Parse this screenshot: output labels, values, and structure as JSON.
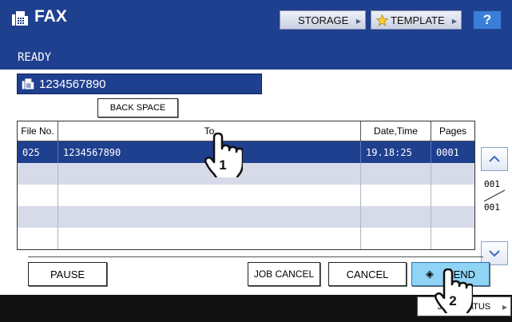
{
  "header": {
    "title": "FAX",
    "storage_label": "STORAGE",
    "template_label": "TEMPLATE",
    "help_label": "?"
  },
  "status": {
    "text": "READY"
  },
  "number_field": {
    "value": "1234567890"
  },
  "buttons": {
    "backspace": "BACK SPACE",
    "pause": "PAUSE",
    "job_cancel": "JOB CANCEL",
    "cancel": "CANCEL",
    "send": "SEND",
    "job_status": "JOB STATUS"
  },
  "table": {
    "columns": [
      "File No.",
      "To",
      "Date,Time",
      "Pages"
    ],
    "rows": [
      {
        "file_no": "025",
        "to": "1234567890",
        "datetime": "19.18:25",
        "pages": "0001"
      }
    ]
  },
  "pager": {
    "current": "001",
    "total": "001"
  },
  "callouts": {
    "first": "1",
    "second": "2"
  },
  "colors": {
    "header_blue": "#1f3f8f",
    "send_highlight": "#8fd3f5",
    "row_alt": "#d7dbe9"
  }
}
